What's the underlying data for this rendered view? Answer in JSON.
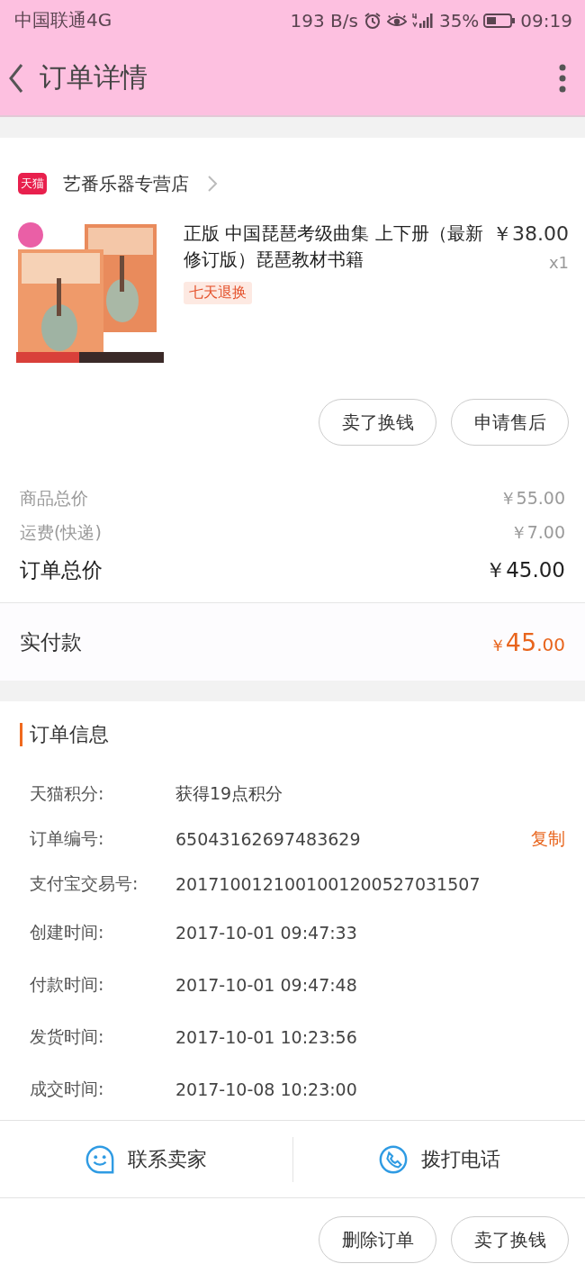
{
  "status_bar": {
    "carrier": "中国联通4G",
    "speed": "193 B/s",
    "battery": "35%",
    "time": "09:19"
  },
  "header": {
    "title": "订单详情"
  },
  "shop": {
    "badge": "天猫",
    "name": "艺番乐器专营店"
  },
  "item": {
    "title": "正版 中国琵琶考级曲集 上下册（最新修订版）琵琶教材书籍",
    "price": "￥38.00",
    "quantity": "x1",
    "tag": "七天退换"
  },
  "item_buttons": [
    "卖了换钱",
    "申请售后"
  ],
  "costs": [
    {
      "label": "商品总价",
      "value": "￥55.00",
      "kind": "minor"
    },
    {
      "label": "运费(快递)",
      "value": "￥7.00",
      "kind": "minor"
    },
    {
      "label": "订单总价",
      "value": "￥45.00",
      "kind": "total"
    }
  ],
  "paid": {
    "label": "实付款",
    "currency": "￥",
    "whole": "45",
    "fraction": ".00"
  },
  "order_info": {
    "title": "订单信息",
    "rows": [
      {
        "label": "天猫积分:",
        "value": "获得19点积分"
      },
      {
        "label": "订单编号:",
        "value": "65043162697483629",
        "action": "复制"
      },
      {
        "label": "支付宝交易号:",
        "value": "2017100121001001200527031507"
      },
      {
        "label": "创建时间:",
        "value": "2017-10-01 09:47:33"
      },
      {
        "label": "付款时间:",
        "value": "2017-10-01 09:47:48"
      },
      {
        "label": "发货时间:",
        "value": "2017-10-01 10:23:56"
      },
      {
        "label": "成交时间:",
        "value": "2017-10-08 10:23:00"
      }
    ]
  },
  "contact": [
    {
      "label": "联系卖家",
      "kind": "chat"
    },
    {
      "label": "拨打电话",
      "kind": "phone"
    }
  ],
  "footer_buttons": [
    "删除订单",
    "卖了换钱"
  ]
}
